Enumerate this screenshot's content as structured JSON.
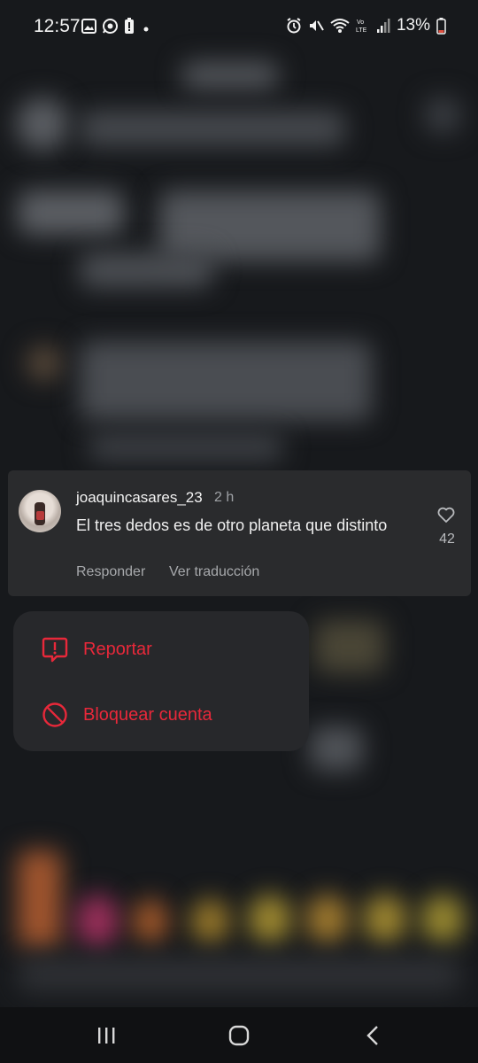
{
  "status_bar": {
    "time": "12:57",
    "battery": "13%",
    "left_icons": [
      "gallery-icon",
      "whatsapp-icon",
      "battery-alert-icon",
      "dot-icon"
    ],
    "right_icons": [
      "alarm-icon",
      "mute-icon",
      "wifi-icon",
      "volte-icon",
      "signal-icon",
      "battery-icon"
    ]
  },
  "comment": {
    "username": "joaquincasares_23",
    "time_ago": "2 h",
    "text": "El tres dedos es de otro planeta que distinto",
    "like_count": "42",
    "reply_label": "Responder",
    "translate_label": "Ver traducción"
  },
  "menu": {
    "items": [
      {
        "label": "Reportar",
        "icon": "report-icon"
      },
      {
        "label": "Bloquear cuenta",
        "icon": "block-icon"
      }
    ]
  },
  "colors": {
    "danger": "#e8283a",
    "card": "#2a2b2d",
    "menu": "#27282b",
    "background": "#17191c"
  },
  "nav_bar": {
    "icons": [
      "recent-apps-icon",
      "home-icon",
      "back-icon"
    ]
  }
}
